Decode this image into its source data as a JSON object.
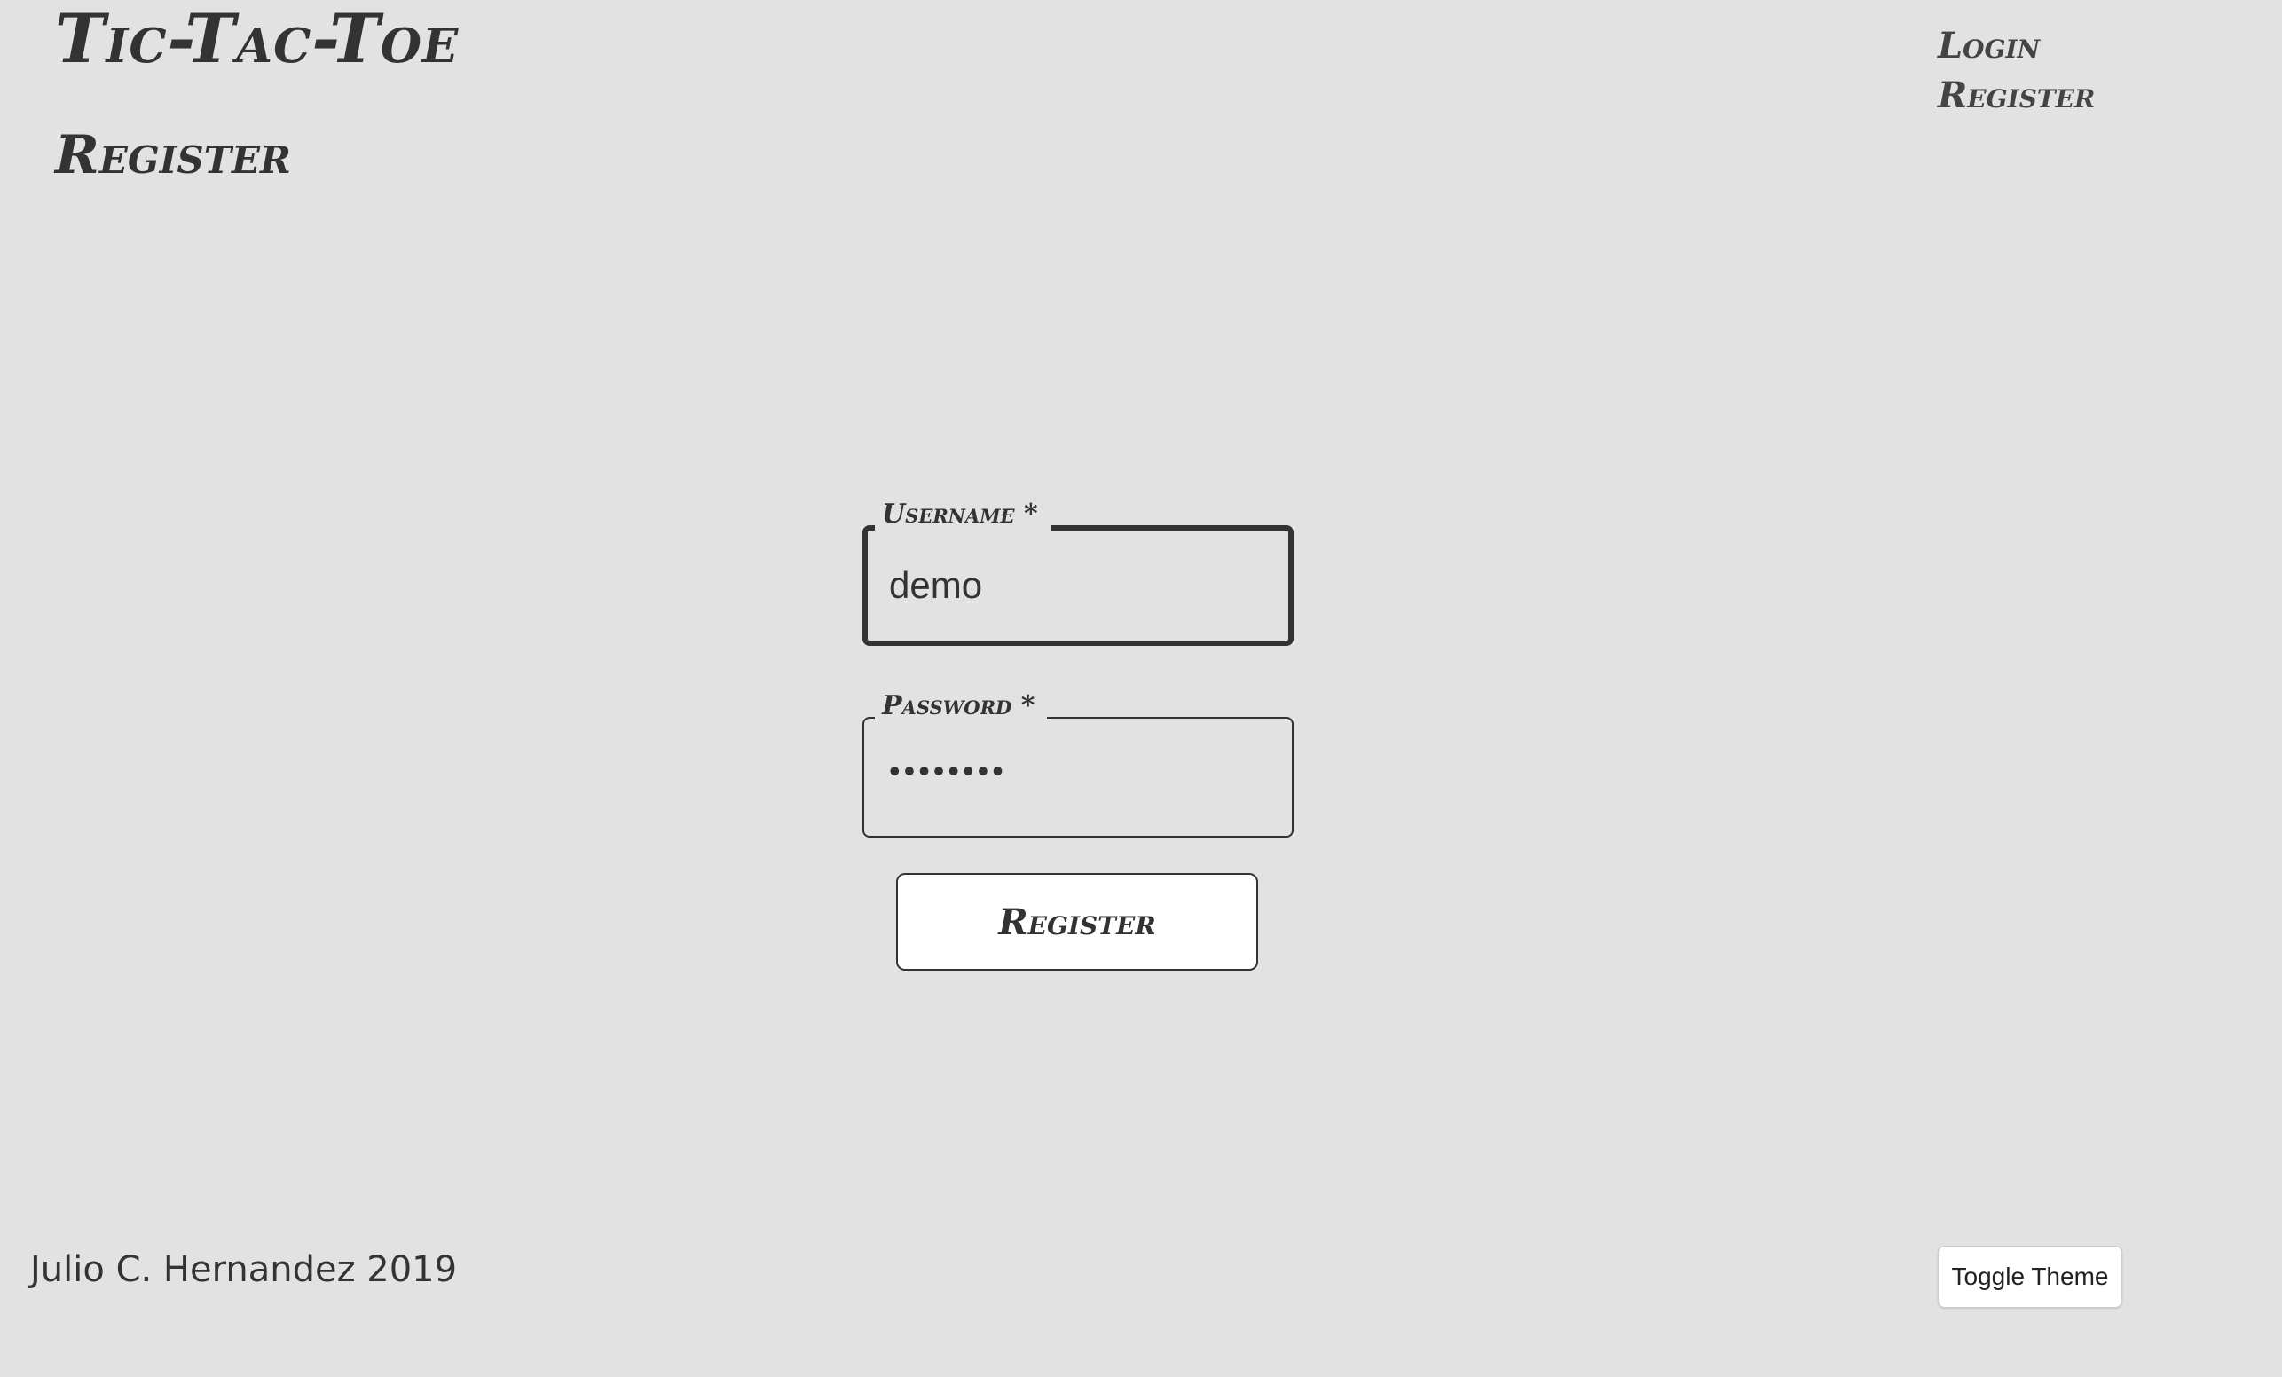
{
  "header": {
    "app_title": "Tic-Tac-Toe",
    "page_heading": "Register"
  },
  "nav": {
    "items": [
      {
        "label": "Login"
      },
      {
        "label": "Register"
      }
    ]
  },
  "form": {
    "username": {
      "label": "Username *",
      "value": "demo"
    },
    "password": {
      "label": "Password *",
      "value": "••••••••"
    },
    "submit_label": "Register"
  },
  "footer": {
    "credit": "Julio C. Hernandez 2019",
    "toggle_theme_label": "Toggle Theme"
  }
}
